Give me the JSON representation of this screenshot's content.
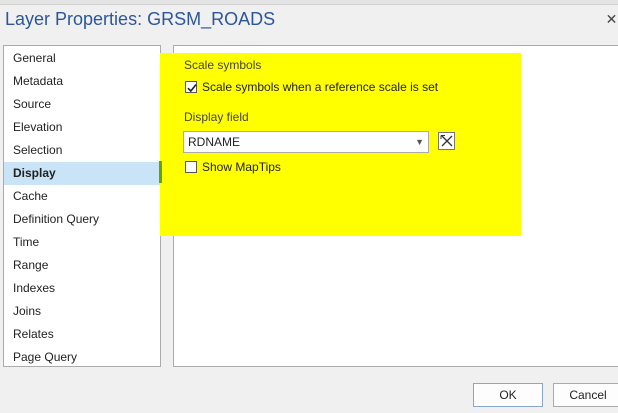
{
  "window": {
    "title": "Layer Properties: GRSM_ROADS"
  },
  "nav": {
    "items": [
      {
        "label": "General",
        "selected": false
      },
      {
        "label": "Metadata",
        "selected": false
      },
      {
        "label": "Source",
        "selected": false
      },
      {
        "label": "Elevation",
        "selected": false
      },
      {
        "label": "Selection",
        "selected": false
      },
      {
        "label": "Display",
        "selected": true
      },
      {
        "label": "Cache",
        "selected": false
      },
      {
        "label": "Definition Query",
        "selected": false
      },
      {
        "label": "Time",
        "selected": false
      },
      {
        "label": "Range",
        "selected": false
      },
      {
        "label": "Indexes",
        "selected": false
      },
      {
        "label": "Joins",
        "selected": false
      },
      {
        "label": "Relates",
        "selected": false
      },
      {
        "label": "Page Query",
        "selected": false
      }
    ]
  },
  "display": {
    "scale_symbols": {
      "section_label": "Scale symbols",
      "checkbox_label": "Scale symbols when a reference scale is set",
      "checked": true
    },
    "display_field": {
      "label": "Display field",
      "value": "RDNAME"
    },
    "map_tips": {
      "label": "Show MapTips",
      "checked": false
    }
  },
  "buttons": {
    "ok": "OK",
    "cancel": "Cancel"
  },
  "colors": {
    "title": "#2b579a",
    "selected_row": "#c9e4f6",
    "highlight": "#ffff00"
  }
}
